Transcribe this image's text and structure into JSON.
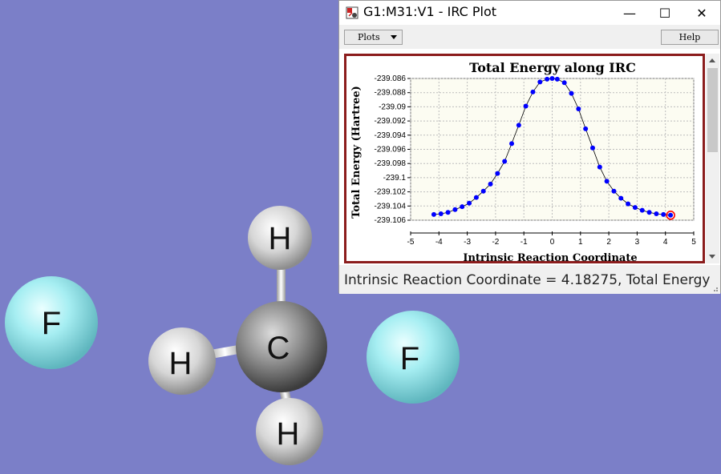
{
  "molecule": {
    "atoms": [
      "F",
      "H",
      "H",
      "C",
      "H",
      "F"
    ]
  },
  "window": {
    "title": "G1:M31:V1 - IRC Plot",
    "controls": {
      "minimize": "—",
      "maximize": "☐",
      "close": "✕"
    }
  },
  "toolbar": {
    "plots_label": "Plots",
    "help_label": "Help"
  },
  "status": {
    "text": "Intrinsic Reaction Coordinate = 4.18275, Total Energy"
  },
  "colors": {
    "background": "#7b7fc8",
    "series": "#0000ff",
    "plot_border": "#8b1c1c",
    "selected_marker": "#ff0000"
  },
  "chart_data": {
    "type": "line",
    "title": "Total Energy along IRC",
    "xlabel": "Intrinsic Reaction Coordinate",
    "ylabel": "Total Energy (Hartree)",
    "xlim": [
      -5,
      5
    ],
    "ylim": [
      -239.106,
      -239.086
    ],
    "xticks": [
      "-5",
      "-4",
      "-3",
      "-2",
      "-1",
      "0",
      "1",
      "2",
      "3",
      "4",
      "5"
    ],
    "yticks": [
      "-239.086",
      "-239.088",
      "-239.09",
      "-239.092",
      "-239.094",
      "-239.096",
      "-239.098",
      "-239.1",
      "-239.102",
      "-239.104",
      "-239.106"
    ],
    "grid": true,
    "series": [
      {
        "x": [
          -4.18,
          -3.93,
          -3.68,
          -3.43,
          -3.18,
          -2.93,
          -2.68,
          -2.43,
          -2.18,
          -1.93,
          -1.68,
          -1.43,
          -1.18,
          -0.93,
          -0.68,
          -0.43,
          -0.18,
          0,
          0.18,
          0.43,
          0.68,
          0.93,
          1.18,
          1.43,
          1.68,
          1.93,
          2.18,
          2.43,
          2.68,
          2.93,
          3.18,
          3.43,
          3.68,
          3.93,
          4.18
        ],
        "y": [
          -239.1052,
          -239.1051,
          -239.1049,
          -239.1045,
          -239.1041,
          -239.1036,
          -239.1028,
          -239.1019,
          -239.1009,
          -239.0994,
          -239.0977,
          -239.0952,
          -239.0926,
          -239.0899,
          -239.0879,
          -239.0865,
          -239.0861,
          -239.086,
          -239.0861,
          -239.0866,
          -239.0881,
          -239.0903,
          -239.0931,
          -239.0958,
          -239.0985,
          -239.1005,
          -239.1019,
          -239.1029,
          -239.1037,
          -239.1042,
          -239.1046,
          -239.1049,
          -239.1051,
          -239.1052,
          -239.1053
        ]
      }
    ],
    "selected_point": {
      "x": 4.18275,
      "y": -239.1053
    }
  }
}
